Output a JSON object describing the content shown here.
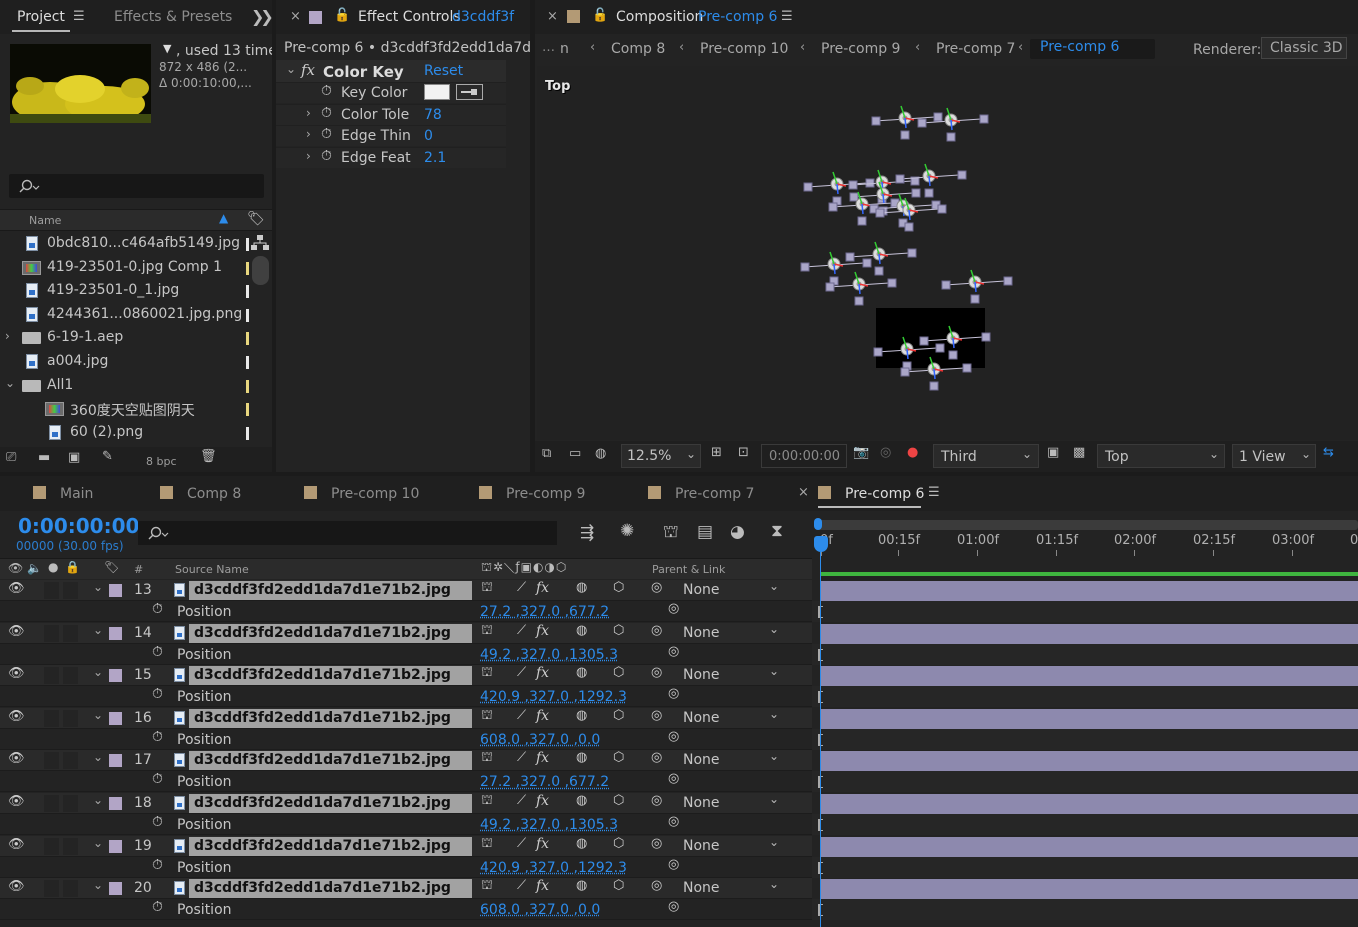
{
  "project_panel": {
    "tab_project": "Project",
    "tab_effects": "Effects & Presets",
    "used_text": ", used 13 time",
    "dims": "872 x 486  (2...",
    "duration": "Δ 0:00:10:00,...",
    "search_placeholder": "",
    "col_name": "Name",
    "items": [
      {
        "name": "0bdc810...c464afb5149.jpg",
        "type": "image",
        "label": "#e8e8e8"
      },
      {
        "name": "419-23501-0.jpg Comp 1",
        "type": "comp",
        "label": "#e8d77f"
      },
      {
        "name": "419-23501-0_1.jpg",
        "type": "image",
        "label": "#e8e8e8"
      },
      {
        "name": "4244361...0860021.jpg.png",
        "type": "image",
        "label": "#e8e8e8"
      },
      {
        "name": "6-19-1.aep",
        "type": "folder",
        "label": "#e8d77f"
      },
      {
        "name": "a004.jpg",
        "type": "image",
        "label": "#e8e8e8"
      },
      {
        "name": "All1",
        "type": "folder-open",
        "label": "#e8d77f"
      },
      {
        "name": "360度天空贴图阴天",
        "type": "comp",
        "label": "#e8d77f"
      },
      {
        "name": "60 (2).png",
        "type": "image",
        "label": "#e8e8e8"
      }
    ],
    "bpc": "8 bpc"
  },
  "effect_controls": {
    "tab_prefix": "Effect Controls",
    "tab_layer": "d3cddf3f",
    "breadcrumb": "Pre-comp 6 • d3cddf3fd2edd1da7d1e7",
    "effect_name": "Color Key",
    "reset": "Reset",
    "props": [
      {
        "label": "Key Color",
        "value": ""
      },
      {
        "label": "Color Tole",
        "value": "78"
      },
      {
        "label": "Edge Thin",
        "value": "0"
      },
      {
        "label": "Edge Feat",
        "value": "2.1"
      }
    ]
  },
  "composition": {
    "tab_prefix": "Composition",
    "tab_name": "Pre-comp 6",
    "nav": [
      "n",
      "Comp 8",
      "Pre-comp 10",
      "Pre-comp 9",
      "Pre-comp 7",
      "Pre-comp 6"
    ],
    "renderer_label": "Renderer:",
    "renderer_value": "Classic 3D",
    "view_label": "Top",
    "zoom": "12.5%",
    "timecode": "0:00:00:00",
    "resolution": "Third",
    "camera": "Top",
    "views": "1 View"
  },
  "timeline": {
    "tabs": [
      "Main",
      "Comp 8",
      "Pre-comp 10",
      "Pre-comp 9",
      "Pre-comp 7",
      "Pre-comp 6"
    ],
    "active_tab": "Pre-comp 6",
    "timecode": "0:00:00:00",
    "frames": "00000 (30.00 fps)",
    "col_hash": "#",
    "col_source": "Source Name",
    "col_parent": "Parent & Link",
    "ruler": [
      "0f",
      "00:15f",
      "01:00f",
      "01:15f",
      "02:00f",
      "02:15f",
      "03:00f",
      "0"
    ],
    "position_label": "Position",
    "parent_none": "None",
    "layers": [
      {
        "num": "13",
        "name": "d3cddf3fd2edd1da7d1e71b2.jpg",
        "position": "27.2 ,327.0 ,677.2"
      },
      {
        "num": "14",
        "name": "d3cddf3fd2edd1da7d1e71b2.jpg",
        "position": "49.2 ,327.0 ,1305.3"
      },
      {
        "num": "15",
        "name": "d3cddf3fd2edd1da7d1e71b2.jpg",
        "position": "420.9 ,327.0 ,1292.3"
      },
      {
        "num": "16",
        "name": "d3cddf3fd2edd1da7d1e71b2.jpg",
        "position": "608.0 ,327.0 ,0.0"
      },
      {
        "num": "17",
        "name": "d3cddf3fd2edd1da7d1e71b2.jpg",
        "position": "27.2 ,327.0 ,677.2"
      },
      {
        "num": "18",
        "name": "d3cddf3fd2edd1da7d1e71b2.jpg",
        "position": "49.2 ,327.0 ,1305.3"
      },
      {
        "num": "19",
        "name": "d3cddf3fd2edd1da7d1e71b2.jpg",
        "position": "420.9 ,327.0 ,1292.3"
      },
      {
        "num": "20",
        "name": "d3cddf3fd2edd1da7d1e71b2.jpg",
        "position": "608.0 ,327.0 ,0.0"
      }
    ]
  },
  "colors": {
    "accent": "#2d8ceb",
    "label_lavender": "#b2a5c6",
    "label_tan": "#b39a75",
    "bar": "#8c88ad"
  }
}
